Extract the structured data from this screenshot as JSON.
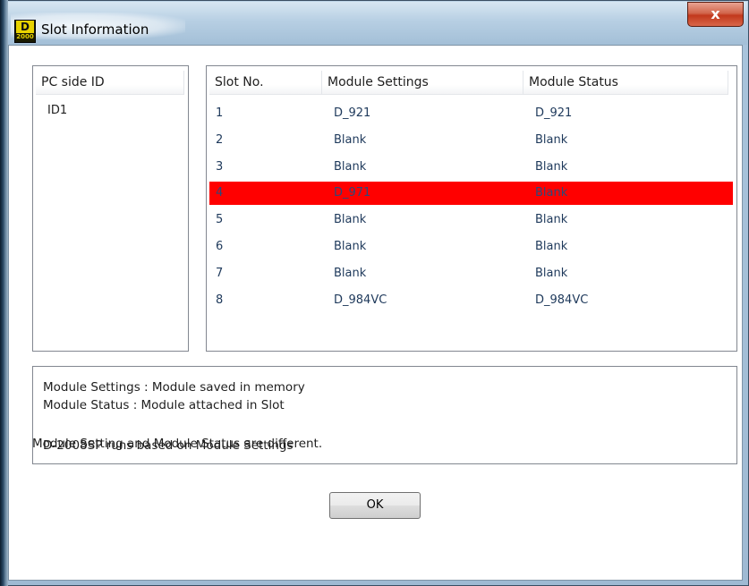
{
  "window": {
    "title": "Slot Information",
    "close_glyph": "x"
  },
  "app_icon": {
    "top": "D",
    "bottom": "2000"
  },
  "pc_side": {
    "header": "PC side ID",
    "items": [
      "ID1"
    ]
  },
  "slot_table": {
    "columns": [
      "Slot No.",
      "Module Settings",
      "Module Status"
    ],
    "rows": [
      {
        "slot": "1",
        "settings": "D_921",
        "status": "D_921"
      },
      {
        "slot": "2",
        "settings": "Blank",
        "status": "Blank"
      },
      {
        "slot": "3",
        "settings": "Blank",
        "status": "Blank"
      },
      {
        "slot": "4",
        "settings": "D_971",
        "status": "Blank",
        "highlighted": true
      },
      {
        "slot": "5",
        "settings": "Blank",
        "status": "Blank"
      },
      {
        "slot": "6",
        "settings": "Blank",
        "status": "Blank"
      },
      {
        "slot": "7",
        "settings": "Blank",
        "status": "Blank"
      },
      {
        "slot": "8",
        "settings": "D_984VC",
        "status": "D_984VC"
      }
    ],
    "highlight_color": "#ff0000"
  },
  "notes": {
    "line1": "Module Settings : Module saved in memory",
    "line2": "Module Status : Module attached in Slot",
    "line3": "D-2008SP runs based on Module Settings"
  },
  "status_message": "Module Setting and Module Status are different.",
  "ok_button": "OK"
}
